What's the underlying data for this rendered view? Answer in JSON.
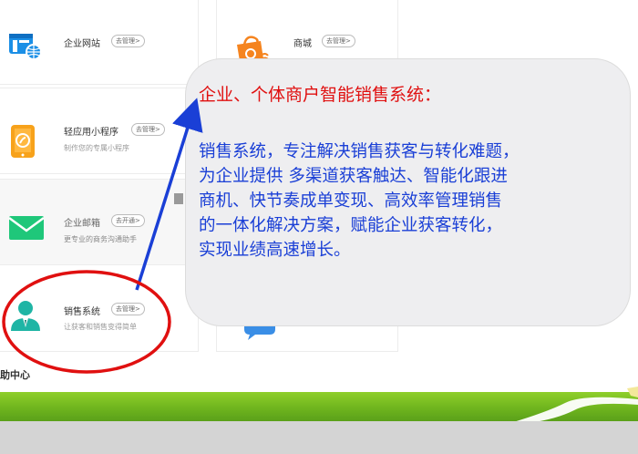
{
  "cards": {
    "website": {
      "title": "企业网站",
      "action": "去管理>"
    },
    "miniapp": {
      "title": "轻应用小程序",
      "action": "去管理>",
      "desc": "制作您的专属小程序"
    },
    "mail": {
      "title": "企业邮箱",
      "action": "去开通>",
      "desc": "更专业的商务沟通助手"
    },
    "sales": {
      "title": "销售系统",
      "action": "去管理>",
      "desc": "让获客和销售变得简单"
    },
    "mall": {
      "title": "商城",
      "action": "去管理>"
    }
  },
  "help_center": "助中心",
  "callout": {
    "title": "企业、个体商户智能销售系统：",
    "lines": [
      "销售系统，专注解决销售获客与转化难题，",
      "为企业提供 多渠道获客触达、智能化跟进",
      "商机、快节奏成单变现、高效率管理销售",
      " 的一体化解决方案，赋能企业获客转化，",
      "实现业绩高速增长。"
    ]
  },
  "colors": {
    "callout_title": "#e01010",
    "callout_body": "#1a3fd6",
    "arrow": "#1a3fd6",
    "ellipse": "#e01010",
    "green_band": "#6fb51e"
  },
  "icons": {
    "website": "browser-globe-icon",
    "miniapp": "mobile-link-icon",
    "mail": "envelope-icon",
    "sales": "user-person-icon",
    "mall": "shopping-bag-icon"
  }
}
